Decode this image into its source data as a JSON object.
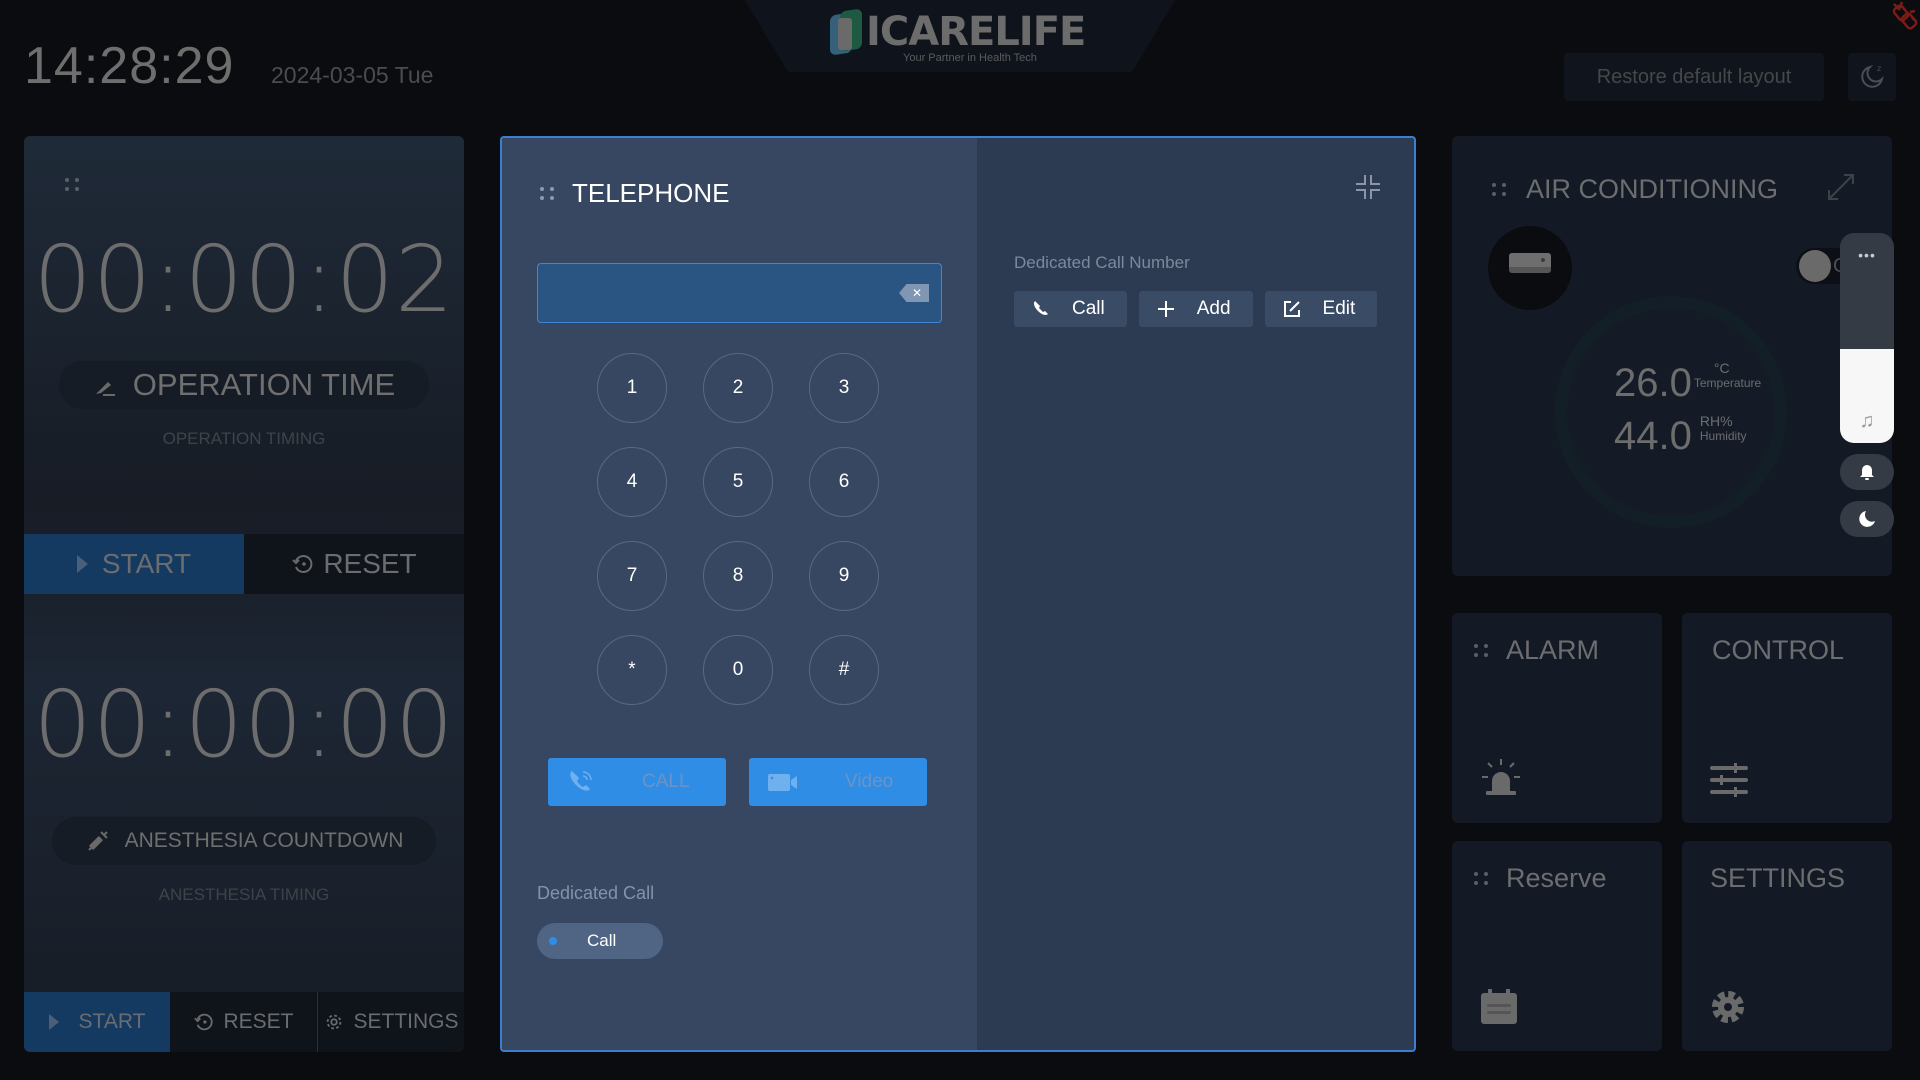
{
  "header": {
    "clock": "14:28:29",
    "date": "2024-03-05 Tue",
    "logo_text": "ICARELIFE",
    "logo_tagline": "Your Partner in Health Tech",
    "restore_label": "Restore default layout",
    "icons": {
      "sleep": "moon-sleep-icon",
      "connection": "disconnected-link-icon"
    }
  },
  "timers": {
    "operation": {
      "time": "00:00:02",
      "label": "OPERATION TIME",
      "sublabel": "OPERATION TIMING",
      "start_label": "START",
      "reset_label": "RESET"
    },
    "anesthesia": {
      "time": "00:00:00",
      "label": "ANESTHESIA COUNTDOWN",
      "sublabel": "ANESTHESIA TIMING",
      "start_label": "START",
      "reset_label": "RESET",
      "settings_label": "SETTINGS"
    }
  },
  "telephone": {
    "title": "TELEPHONE",
    "dial_value": "",
    "keys": [
      "1",
      "2",
      "3",
      "4",
      "5",
      "6",
      "7",
      "8",
      "9",
      "*",
      "0",
      "#"
    ],
    "call_label": "CALL",
    "video_label": "Video",
    "dedicated_call_label": "Dedicated Call",
    "dedicated_call_chip": "Call",
    "dedicated_number_label": "Dedicated Call Number",
    "number_actions": [
      {
        "label": "Call",
        "icon": "phone-icon"
      },
      {
        "label": "Add",
        "icon": "plus-icon"
      },
      {
        "label": "Edit",
        "icon": "edit-icon"
      }
    ],
    "accent": "#2f8de6"
  },
  "air_conditioning": {
    "title": "AIR CONDITIONING",
    "power_state": "Off",
    "temperature": "26.0",
    "temperature_unit": "°C",
    "temperature_label": "Temperature",
    "humidity": "44.0",
    "humidity_unit": "RH%",
    "humidity_label": "Humidity"
  },
  "side_controls": {
    "volume_level": 0.45,
    "menu_glyph": "•••",
    "note_glyph": "♫"
  },
  "tiles": {
    "alarm": "ALARM",
    "control": "CONTROL",
    "reserve": "Reserve",
    "settings": "SETTINGS"
  }
}
